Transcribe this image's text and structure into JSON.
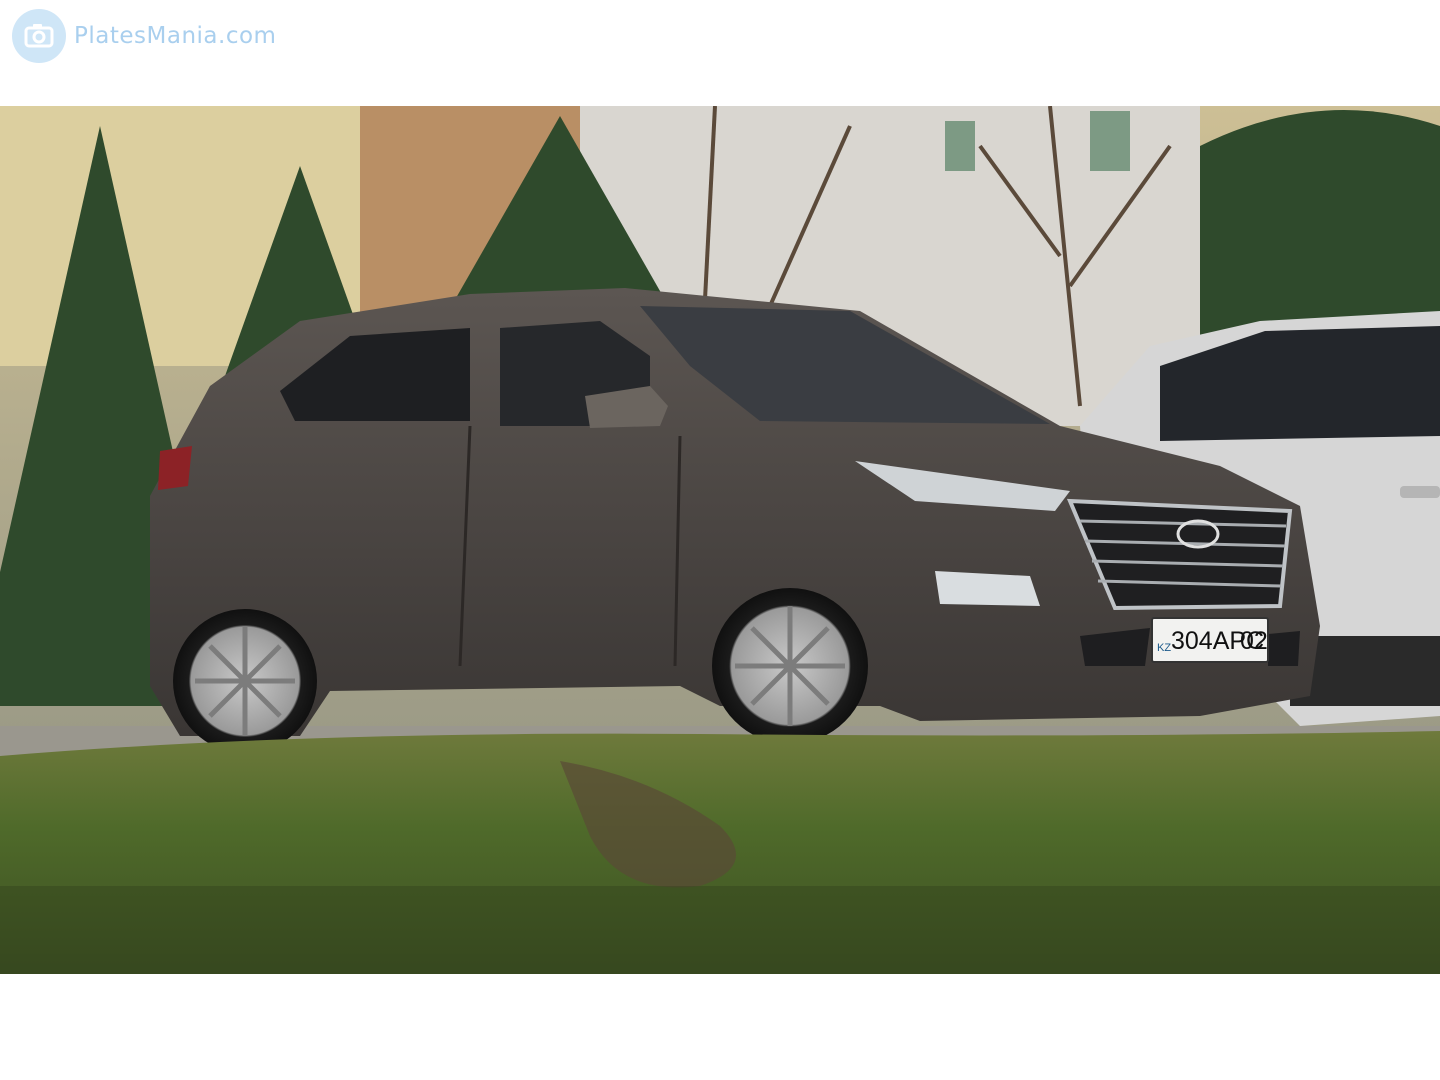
{
  "watermark": {
    "site": "PlatesMania.com",
    "icon": "camera-icon",
    "color": "#a9cfee"
  },
  "photo": {
    "subject": "dark-grey Hyundai SUV",
    "plate": {
      "country_code": "KZ",
      "number": "304APC",
      "region": "02"
    }
  },
  "colors": {
    "car_body": "#4a4542",
    "grass": "#4f6a2a",
    "sky_building": "#d9cfa8"
  }
}
